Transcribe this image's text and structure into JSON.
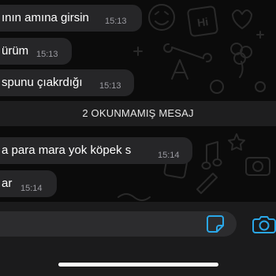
{
  "messages": [
    {
      "text": "ının amına girsin",
      "time": "15:13"
    },
    {
      "text": "ürüm",
      "time": "15:13"
    },
    {
      "text": "spunu çıakrdığı",
      "time": "15:13"
    },
    {
      "text": "a para mara yok köpek s",
      "time": "15:14"
    },
    {
      "text": "ar",
      "time": "15:14"
    }
  ],
  "unread_banner": "2 OKUNMAMIŞ MESAJ",
  "doodle": {
    "hi_text": "Hi"
  },
  "input": {
    "placeholder": ""
  },
  "icons": {
    "sticker": "sticker-icon",
    "camera": "camera-icon"
  },
  "colors": {
    "accent": "#2aa7e8",
    "bubble": "#262628",
    "time": "#9a9aa0"
  }
}
